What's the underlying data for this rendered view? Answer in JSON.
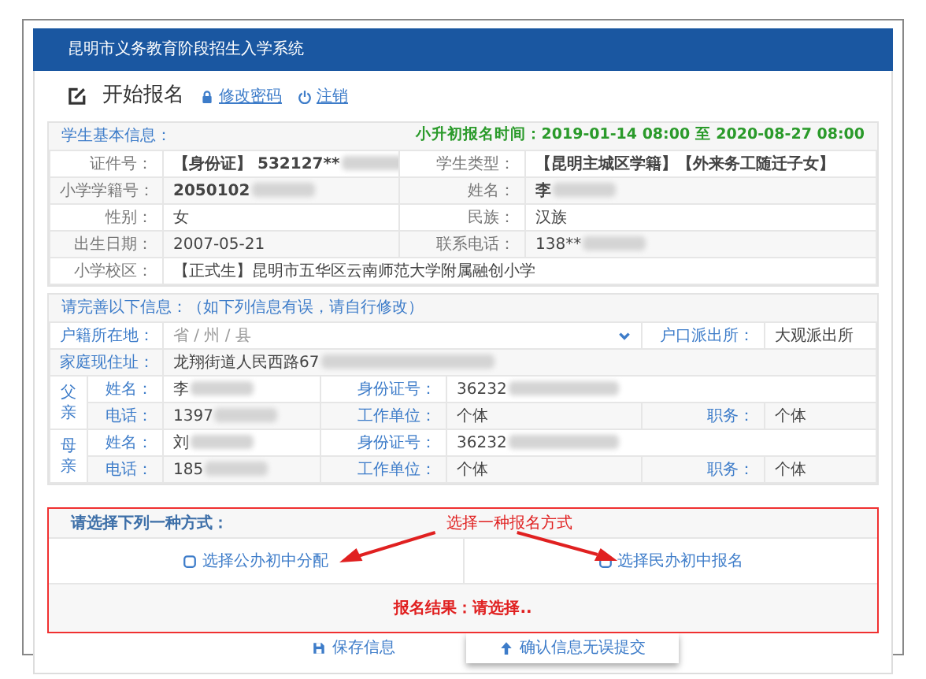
{
  "header": {
    "title": "昆明市义务教育阶段招生入学系统"
  },
  "page": {
    "title": "开始报名",
    "links": [
      {
        "label": "修改密码"
      },
      {
        "label": "注销"
      }
    ]
  },
  "student_info": {
    "heading": "学生基本信息：",
    "period": "小升初报名时间：2019-01-14 08:00 至 2020-08-27 08:00",
    "rows": [
      [
        {
          "label": "证件号：",
          "value": "【身份证】 532127**",
          "bold": true,
          "blurred": true
        },
        {
          "label": "学生类型：",
          "value": "【昆明主城区学籍】【外来务工随迁子女】",
          "bold": true,
          "blurred": false
        }
      ],
      [
        {
          "label": "小学学籍号：",
          "value": "2050102",
          "bold": true,
          "blurred": true
        },
        {
          "label": "姓名：",
          "value": "李",
          "bold": true,
          "blurred": true
        }
      ],
      [
        {
          "label": "性别：",
          "value": "女",
          "bold": false,
          "blurred": false
        },
        {
          "label": "民族：",
          "value": "汉族",
          "bold": false,
          "blurred": false
        }
      ],
      [
        {
          "label": "出生日期：",
          "value": "2007-05-21",
          "bold": false,
          "blurred": false
        },
        {
          "label": "联系电话：",
          "value": "138**",
          "bold": false,
          "blurred": true
        }
      ],
      [
        {
          "label": "小学校区：",
          "value": "【正式生】昆明市五华区云南师范大学附属融创小学",
          "bold": false,
          "blurred": false
        }
      ]
    ]
  },
  "family_info": {
    "heading": "请完善以下信息：（如下列信息有误，请自行修改）",
    "origin": {
      "label": "户籍所在地：",
      "select": "省 / 州 / 县",
      "police_label": "户口派出所：",
      "police": "大观派出所"
    },
    "address": {
      "label": "家庭现住址：",
      "value": "龙翔街道人民西路67",
      "blurred": true
    },
    "parents": [
      {
        "relation": "父亲",
        "rows": [
          [
            {
              "label": "姓名：",
              "value": "李",
              "blurred": true
            },
            {
              "label": "身份证号：",
              "value": "36232",
              "blurred": true
            }
          ],
          [
            {
              "label": "电话：",
              "value": "1397",
              "blurred": true
            },
            {
              "label": "工作单位：",
              "value": "个体",
              "blurred": false
            },
            {
              "label": "职务：",
              "value": "个体",
              "blurred": false
            }
          ]
        ]
      },
      {
        "relation": "母亲",
        "rows": [
          [
            {
              "label": "姓名：",
              "value": "刘",
              "blurred": true
            },
            {
              "label": "身份证号：",
              "value": "36232",
              "blurred": true
            }
          ],
          [
            {
              "label": "电话：",
              "value": "185",
              "blurred": true
            },
            {
              "label": "工作单位：",
              "value": "个体",
              "blurred": false
            },
            {
              "label": "职务：",
              "value": "个体",
              "blurred": false
            }
          ]
        ]
      }
    ]
  },
  "choice": {
    "heading": "请选择下列一种方式：",
    "annotation": "选择一种报名方式",
    "options": [
      {
        "label": "选择公办初中分配",
        "checked": false
      },
      {
        "label": "选择民办初中报名",
        "checked": false
      }
    ],
    "result": "报名结果：请选择.."
  },
  "buttons": [
    {
      "label": "保存信息",
      "raised": false
    },
    {
      "label": "确认信息无误提交",
      "raised": true
    }
  ]
}
